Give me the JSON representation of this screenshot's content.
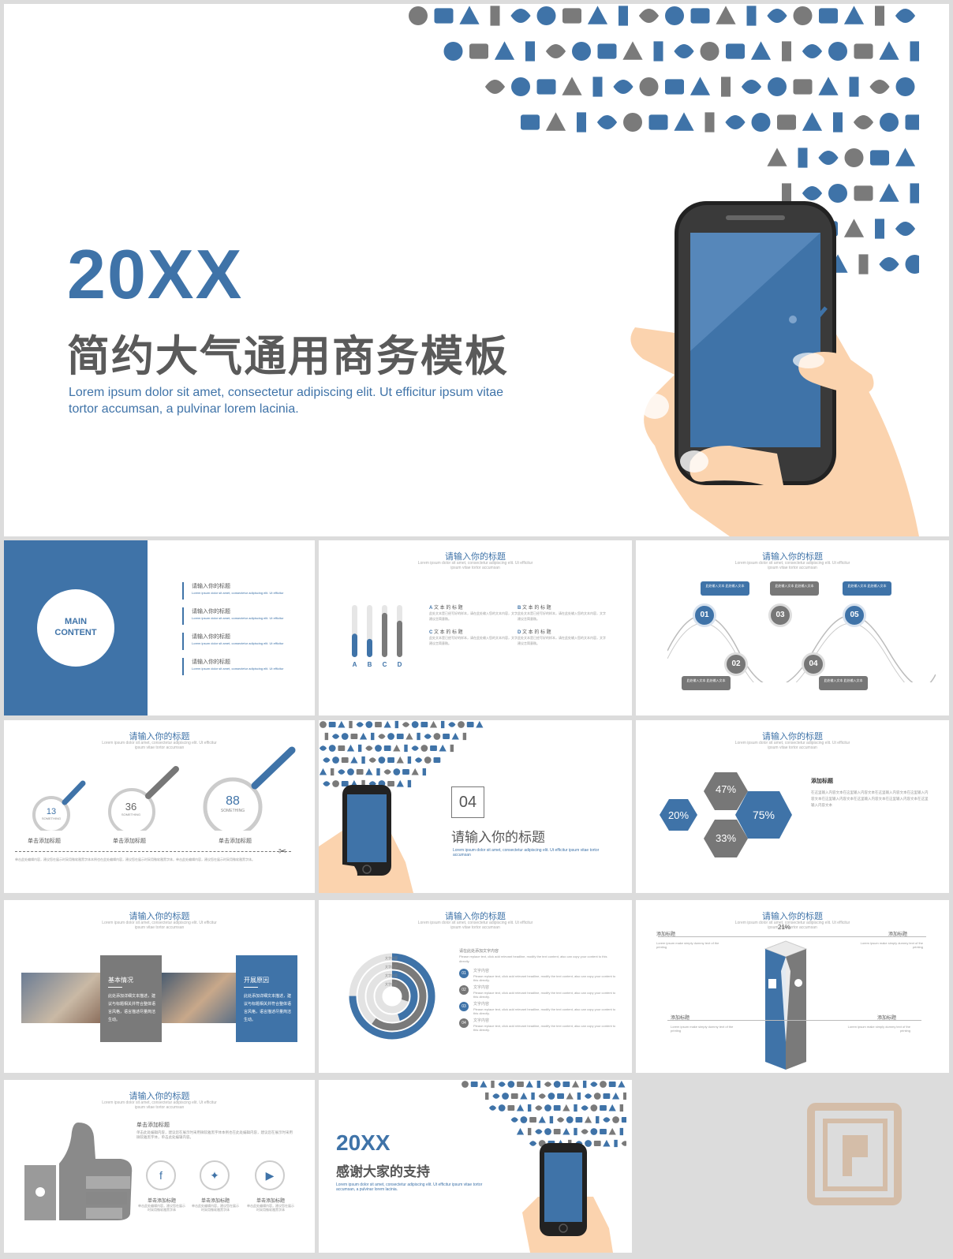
{
  "hero": {
    "year": "20XX",
    "title": "简约大气通用商务模板",
    "subtitle": "Lorem ipsum dolor sit amet, consectetur adipiscing elit. Ut efficitur ipsum vitae tortor accumsan, a pulvinar lorem lacinia."
  },
  "colors": {
    "accent": "#3f73a8",
    "gray": "#7a7a7a",
    "background": "#ffffff"
  },
  "slide1": {
    "circle_line1": "MAIN",
    "circle_line2": "CONTENT",
    "items": [
      {
        "title": "请输入你的标题",
        "desc": "Lorem ipsum dolor sit amet, consectetur adipiscing elit. Ut efficitur"
      },
      {
        "title": "请输入你的标题",
        "desc": "Lorem ipsum dolor sit amet, consectetur adipiscing elit. Ut efficitur"
      },
      {
        "title": "请输入你的标题",
        "desc": "Lorem ipsum dolor sit amet, consectetur adipiscing elit. Ut efficitur"
      },
      {
        "title": "请输入你的标题",
        "desc": "Lorem ipsum dolor sit amet, consectetur adipiscing elit. Ut efficitur"
      }
    ]
  },
  "slide2": {
    "title": "请输入你的标题",
    "subtitle": "Lorem ipsum dolor sit amet, consectetur adipiscing elit. Ut efficitur ipsum vitae tortor accumsan",
    "bars": [
      {
        "label": "A",
        "level": 0.45
      },
      {
        "label": "B",
        "level": 0.35
      },
      {
        "label": "C",
        "level": 0.85
      },
      {
        "label": "D",
        "level": 0.7
      }
    ],
    "blocks": [
      {
        "letter": "A",
        "heading": "文 本 的 标 题",
        "text": "此处文本是已经写好的样本，请在此处输入您的文本内容，文字建议言简意赅。"
      },
      {
        "letter": "B",
        "heading": "文 本 的 标 题",
        "text": "此处文本是已经写好的样本，请在此处输入您的文本内容，文字建议言简意赅。"
      },
      {
        "letter": "C",
        "heading": "文 本 的 标 题",
        "text": "此处文本是已经写好的样本，请在此处输入您的文本内容，文字建议言简意赅。"
      },
      {
        "letter": "D",
        "heading": "文 本 的 标 题",
        "text": "此处文本是已经写好的样本，请在此处输入您的文本内容，文字建议言简意赅。"
      }
    ]
  },
  "slide3": {
    "title": "请输入你的标题",
    "subtitle": "Lorem ipsum dolor sit amet, consectetur adipiscing elit. Ut efficitur ipsum vitae tortor accumsan",
    "nodes": [
      {
        "num": "01",
        "text": "此处输入文本 此处输入文本"
      },
      {
        "num": "02",
        "text": "此处输入文本 此处输入文本"
      },
      {
        "num": "03",
        "text": "此处输入文本 此处输入文本"
      },
      {
        "num": "04",
        "text": "此处输入文本 此处输入文本"
      },
      {
        "num": "05",
        "text": "此处输入文本 此处输入文本"
      }
    ]
  },
  "slide4": {
    "title": "请输入你的标题",
    "subtitle": "Lorem ipsum dolor sit amet, consectetur adipiscing elit. Ut efficitur ipsum vitae tortor accumsan",
    "stats": [
      {
        "value": "13",
        "unit": "SOMETHING",
        "label": "单击添加标题"
      },
      {
        "value": "36",
        "unit": "SOMETHING",
        "label": "单击添加标题"
      },
      {
        "value": "88",
        "unit": "SOMETHING",
        "label": "单击添加标题"
      }
    ],
    "body": "单击此处编辑内容，建议您在展示时采用微软雅黑字体本例也在此处编辑内容，建议您在展示时采用微软雅黑字体，单击此处编辑内容，建议您在展示时采用微软雅黑字体。"
  },
  "slide5": {
    "number": "04",
    "title": "请输入你的标题",
    "subtitle": "Lorem ipsum dolor sit amet, consectetur adipiscing elit. Ut efficitur ipsum vitae tortor accumsan"
  },
  "slide6": {
    "title": "请输入你的标题",
    "subtitle": "Lorem ipsum dolor sit amet, consectetur adipiscing elit. Ut efficitur ipsum vitae tortor accumsan",
    "hexes": [
      "47%",
      "20%",
      "75%",
      "33%"
    ],
    "heading": "添加标题",
    "text": "在这里输入内容文本在这里输入内容文本在这里输入内容文本在这里输入内容文本在这里输入内容文本在这里输入内容文本在这里输入内容文本在这里输入内容文本"
  },
  "slide7": {
    "title": "请输入你的标题",
    "subtitle": "Lorem ipsum dolor sit amet, consectetur adipiscing elit. Ut efficitur ipsum vitae tortor accumsan",
    "box1_title": "基本情况",
    "box1_text": "此处添加详细文本描述，建议与标题相关并符合整体语言风格，语言描述尽量简洁生动。",
    "box2_title": "开展原因",
    "box2_text": "此处添加详细文本描述，建议与标题相关并符合整体语言风格，语言描述尽量简洁生动。"
  },
  "slide8": {
    "title": "请输入你的标题",
    "subtitle": "Lorem ipsum dolor sit amet, consectetur adipiscing elit. Ut efficitur ipsum vitae tortor accumsan",
    "ring_labels": [
      "文字内容",
      "文字内容",
      "文字内容",
      "文字内容"
    ],
    "ring_levels": [
      0.75,
      0.6,
      0.45,
      0.3
    ],
    "top_heading": "请在此处添加文字内容",
    "items": [
      {
        "num": "01",
        "heading": "文字内容"
      },
      {
        "num": "02",
        "heading": "文字内容"
      },
      {
        "num": "03",
        "heading": "文字内容"
      },
      {
        "num": "04",
        "heading": "文字内容"
      }
    ],
    "item_text": "Please replace text, click add relevant headline, modify the text content, also can copy your content to this directly."
  },
  "slide9": {
    "title": "请输入你的标题",
    "subtitle": "Lorem ipsum dolor sit amet, consectetur adipiscing elit. Ut efficitur ipsum vitae tortor accumsan",
    "percent": "21%",
    "labels": [
      "添加标题",
      "添加标题",
      "添加标题",
      "添加标题"
    ],
    "label_text": "Lorem ipsum make simply dummy text of the printing"
  },
  "slide10": {
    "title": "请输入你的标题",
    "subtitle": "Lorem ipsum dolor sit amet, consectetur adipiscing elit. Ut efficitur ipsum vitae tortor accumsan",
    "heading": "单击添加标题",
    "body": "单击此处编辑内容，建议您在展示时采用微软雅黑字体本例也在此处编辑内容，建议您在展示时采用微软雅黑字体，单击此处编辑内容。",
    "icons": [
      {
        "label": "单击添加标题",
        "text": "单击此处编辑内容，建议您在展示时采用微软雅黑字体"
      },
      {
        "label": "单击添加标题",
        "text": "单击此处编辑内容，建议您在展示时采用微软雅黑字体"
      },
      {
        "label": "单击添加标题",
        "text": "单击此处编辑内容，建议您在展示时采用微软雅黑字体"
      }
    ]
  },
  "slide11": {
    "year": "20XX",
    "title": "感谢大家的支持",
    "subtitle": "Lorem ipsum dolor sit amet, consectetur adipiscing elit. Ut efficitur ipsum vitae tortor accumsan, a pulvinar lorem lacinia."
  }
}
